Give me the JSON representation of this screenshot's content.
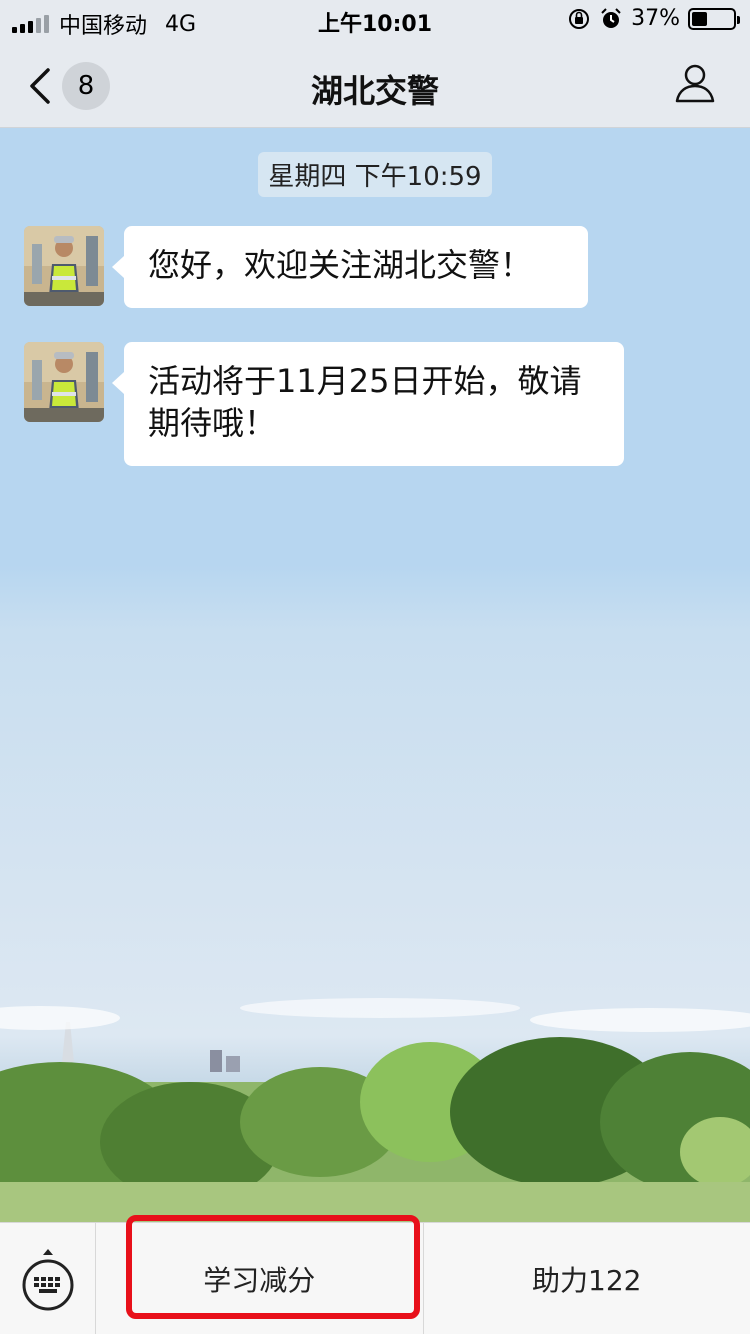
{
  "status_bar": {
    "carrier": "中国移动",
    "network": "4G",
    "time": "上午10:01",
    "battery_percent": "37%",
    "battery_level": 0.37,
    "icons": [
      "signal-icon",
      "orientation-lock-icon",
      "alarm-icon",
      "battery-icon"
    ]
  },
  "nav": {
    "title": "湖北交警",
    "unread_count": "8",
    "icons": [
      "back-chevron-icon",
      "profile-icon"
    ]
  },
  "chat": {
    "timestamp": "星期四 下午10:59",
    "messages": [
      {
        "text": "您好，欢迎关注湖北交警！"
      },
      {
        "text": "活动将于11月25日开始，敬请期待哦！"
      }
    ]
  },
  "bottom_menu": {
    "items": [
      {
        "label": "学习减分"
      },
      {
        "label": "助力122"
      }
    ],
    "icons": [
      "keyboard-icon"
    ]
  },
  "colors": {
    "bar_background": "#e6eaef",
    "chat_background": "#b7d6f0",
    "highlight": "#e8101a"
  }
}
